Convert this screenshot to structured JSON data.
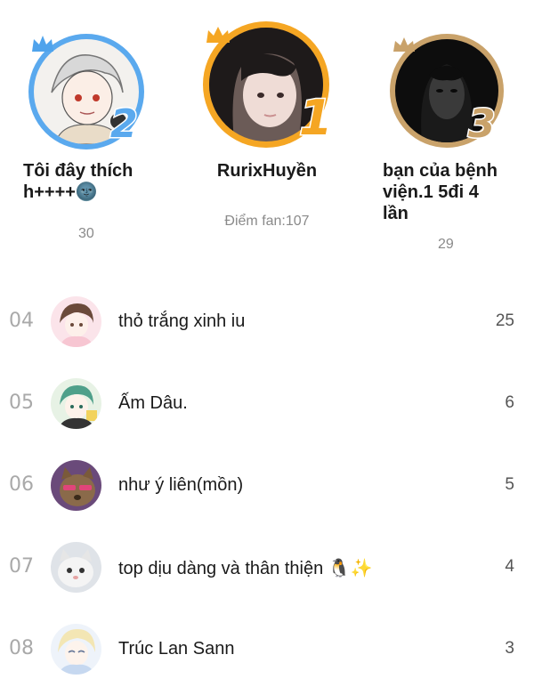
{
  "podium": {
    "first": {
      "rank": "1",
      "name": "RurixHuyền",
      "score_label": "Điểm fan:107",
      "ring_color": "#f5a623"
    },
    "second": {
      "rank": "2",
      "name": "Tôi đây thích h++++🌚",
      "score": "30",
      "ring_color": "#5aa9ee"
    },
    "third": {
      "rank": "3",
      "name": "bạn của bệnh viện.1 5đi 4 lần",
      "score": "29",
      "ring_color": "#c9a26a"
    }
  },
  "list": [
    {
      "rank": "04",
      "name": "thỏ trắng xinh iu",
      "score": "25"
    },
    {
      "rank": "05",
      "name": "Ấm Dâu.",
      "score": "6"
    },
    {
      "rank": "06",
      "name": "như ý liên(mồn)",
      "score": "5"
    },
    {
      "rank": "07",
      "name": "top dịu dàng và thân thiện 🐧✨",
      "score": "4"
    },
    {
      "rank": "08",
      "name": "Trúc Lan Sann",
      "score": "3"
    }
  ]
}
